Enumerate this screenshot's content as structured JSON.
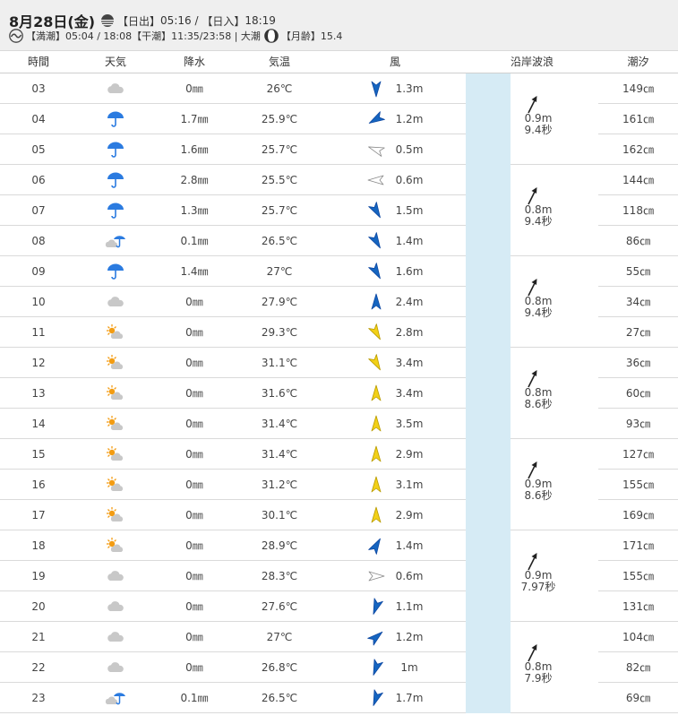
{
  "header": {
    "date": "8月28日(金)",
    "sunrise_label": "【日出】",
    "sunrise": "05:16",
    "sunset_label": "【日入】",
    "sunset": "18:19",
    "high_tide_label": "【満潮】",
    "high_tide": "05:04 / 18:08",
    "low_tide_label": "【干潮】",
    "low_tide": "11:35/23:58",
    "tide_type": "大潮",
    "moon_age_label": "【月齢】",
    "moon_age": "15.4"
  },
  "columns": [
    "時間",
    "天気",
    "降水",
    "気温",
    "風",
    "沿岸波浪",
    "潮汐"
  ],
  "rows": [
    {
      "time": "03",
      "weather": "cloudy-icon",
      "rain": "0㎜",
      "temp": "26℃",
      "wind_dir": "N",
      "wind": "1.3m",
      "tide": "149㎝"
    },
    {
      "time": "04",
      "weather": "umbrella-icon",
      "rain": "1.7㎜",
      "temp": "25.9℃",
      "wind_dir": "NE",
      "wind": "1.2m",
      "tide": "161㎝"
    },
    {
      "time": "05",
      "weather": "umbrella-icon",
      "rain": "1.6㎜",
      "temp": "25.7℃",
      "wind_dir": "E-weak",
      "wind": "0.5m",
      "tide": "162㎝"
    },
    {
      "time": "06",
      "weather": "umbrella-icon",
      "rain": "2.8㎜",
      "temp": "25.5℃",
      "wind_dir": "E-weak2",
      "wind": "0.6m",
      "tide": "144㎝"
    },
    {
      "time": "07",
      "weather": "umbrella-icon",
      "rain": "1.3㎜",
      "temp": "25.7℃",
      "wind_dir": "NW",
      "wind": "1.5m",
      "tide": "118㎝"
    },
    {
      "time": "08",
      "weather": "cloud-umbrella-icon",
      "rain": "0.1㎜",
      "temp": "26.5℃",
      "wind_dir": "NW",
      "wind": "1.4m",
      "tide": "86㎝"
    },
    {
      "time": "09",
      "weather": "umbrella-icon",
      "rain": "1.4㎜",
      "temp": "27℃",
      "wind_dir": "NW",
      "wind": "1.6m",
      "tide": "55㎝"
    },
    {
      "time": "10",
      "weather": "cloudy-icon",
      "rain": "0㎜",
      "temp": "27.9℃",
      "wind_dir": "S-blue",
      "wind": "2.4m",
      "tide": "34㎝"
    },
    {
      "time": "11",
      "weather": "sun-cloud-icon",
      "rain": "0㎜",
      "temp": "29.3℃",
      "wind_dir": "NW-yellow",
      "wind": "2.8m",
      "tide": "27㎝"
    },
    {
      "time": "12",
      "weather": "sun-cloud-icon",
      "rain": "0㎜",
      "temp": "31.1℃",
      "wind_dir": "NW-yellow",
      "wind": "3.4m",
      "tide": "36㎝"
    },
    {
      "time": "13",
      "weather": "sun-cloud-icon",
      "rain": "0㎜",
      "temp": "31.6℃",
      "wind_dir": "S-yellow",
      "wind": "3.4m",
      "tide": "60㎝"
    },
    {
      "time": "14",
      "weather": "sun-cloud-icon",
      "rain": "0㎜",
      "temp": "31.4℃",
      "wind_dir": "S-yellow",
      "wind": "3.5m",
      "tide": "93㎝"
    },
    {
      "time": "15",
      "weather": "sun-cloud-icon",
      "rain": "0㎜",
      "temp": "31.4℃",
      "wind_dir": "S-yellow",
      "wind": "2.9m",
      "tide": "127㎝"
    },
    {
      "time": "16",
      "weather": "sun-cloud-icon",
      "rain": "0㎜",
      "temp": "31.2℃",
      "wind_dir": "S-yellow",
      "wind": "3.1m",
      "tide": "155㎝"
    },
    {
      "time": "17",
      "weather": "sun-cloud-icon",
      "rain": "0㎜",
      "temp": "30.1℃",
      "wind_dir": "S-yellow",
      "wind": "2.9m",
      "tide": "169㎝"
    },
    {
      "time": "18",
      "weather": "sun-cloud-icon",
      "rain": "0㎜",
      "temp": "28.9℃",
      "wind_dir": "SE-blue",
      "wind": "1.4m",
      "tide": "171㎝"
    },
    {
      "time": "19",
      "weather": "cloudy-icon",
      "rain": "0㎜",
      "temp": "28.3℃",
      "wind_dir": "W-weak",
      "wind": "0.6m",
      "tide": "155㎝"
    },
    {
      "time": "20",
      "weather": "cloudy-icon",
      "rain": "0㎜",
      "temp": "27.6℃",
      "wind_dir": "SW-blue",
      "wind": "1.1m",
      "tide": "131㎝"
    },
    {
      "time": "21",
      "weather": "cloudy-icon",
      "rain": "0㎜",
      "temp": "27℃",
      "wind_dir": "SE2-blue",
      "wind": "1.2m",
      "tide": "104㎝"
    },
    {
      "time": "22",
      "weather": "cloudy-icon",
      "rain": "0㎜",
      "temp": "26.8℃",
      "wind_dir": "SW-blue",
      "wind": "1m",
      "tide": "82㎝"
    },
    {
      "time": "23",
      "weather": "cloud-umbrella-icon",
      "rain": "0.1㎜",
      "temp": "26.5℃",
      "wind_dir": "SW-blue",
      "wind": "1.7m",
      "tide": "69㎝"
    }
  ],
  "waves": [
    {
      "height": "0.9m",
      "period": "9.4秒"
    },
    {
      "height": "0.8m",
      "period": "9.4秒"
    },
    {
      "height": "0.8m",
      "period": "9.4秒"
    },
    {
      "height": "0.8m",
      "period": "8.6秒"
    },
    {
      "height": "0.9m",
      "period": "8.6秒"
    },
    {
      "height": "0.9m",
      "period": "7.97秒"
    },
    {
      "height": "0.8m",
      "period": "7.9秒"
    }
  ],
  "colors": {
    "header_bg": "#efefef",
    "wave_bg": "#d6ebf5",
    "rain_blue": "#2b7be0",
    "wind_blue": "#1565c0",
    "wind_yellow": "#f2d017"
  }
}
